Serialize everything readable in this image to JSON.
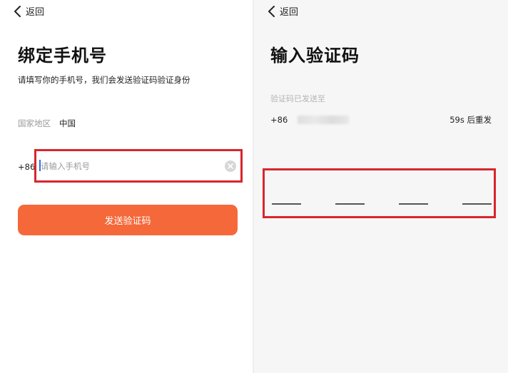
{
  "bind_phone_screen": {
    "back_label": "返回",
    "title": "绑定手机号",
    "subtitle": "请填写你的手机号，我们会发送验证码验证身份",
    "region_label": "国家地区",
    "region_value": "中国",
    "country_code": "+86",
    "phone_input": {
      "value": "",
      "placeholder": "请输入手机号"
    },
    "send_button_label": "发送验证码",
    "button_color": "#f5683a",
    "highlight_color": "#d8262c"
  },
  "verify_code_screen": {
    "back_label": "返回",
    "title": "输入验证码",
    "sent_to_label": "验证码已发送至",
    "country_code": "+86",
    "resend_countdown": "59s 后重发",
    "code_slots": [
      "",
      "",
      "",
      ""
    ]
  }
}
